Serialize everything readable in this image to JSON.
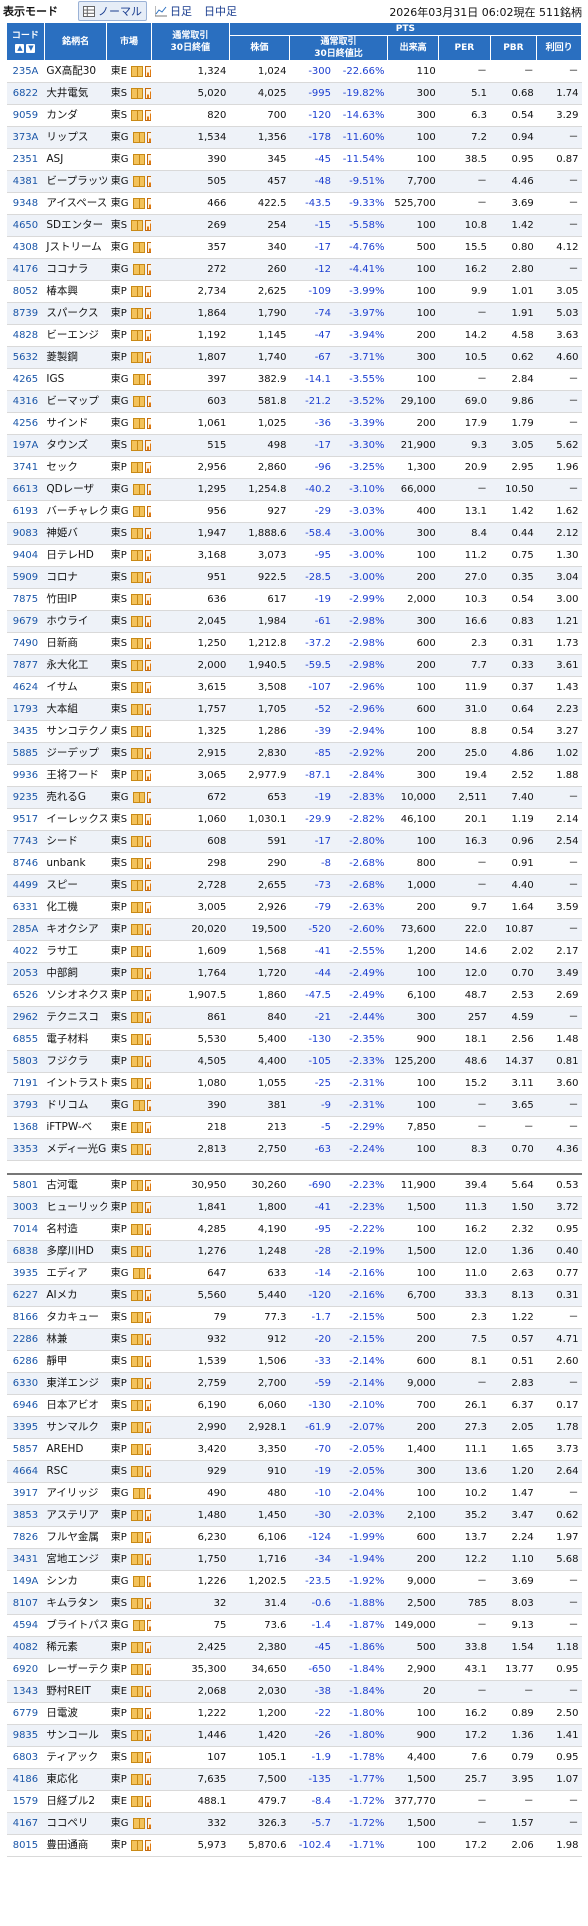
{
  "header": {
    "mode_label": "表示モード",
    "tabs": [
      "ノーマル",
      "日足",
      "日中足"
    ],
    "timestamp": "2026年03月31日  06:02現在  511銘柄"
  },
  "table_headers": {
    "code": "コード",
    "name": "銘柄名",
    "market": "市場",
    "normal_30d_avg": "通常取引\n30日終値",
    "pts_group": "PTS",
    "pts_price": "株価",
    "pts_change": "通常取引\n30日終値比",
    "volume": "出来高",
    "per": "PER",
    "pbr": "PBR",
    "yield": "利回り"
  },
  "rows": [
    [
      "235A",
      "GX高配30",
      "東E",
      "1,324",
      "1,024",
      "-300",
      "-22.66%",
      "110",
      "－",
      "－",
      "－"
    ],
    [
      "6822",
      "大井電気",
      "東S",
      "5,020",
      "4,025",
      "-995",
      "-19.82%",
      "300",
      "5.1",
      "0.68",
      "1.74"
    ],
    [
      "9059",
      "カンダ",
      "東S",
      "820",
      "700",
      "-120",
      "-14.63%",
      "300",
      "6.3",
      "0.54",
      "3.29"
    ],
    [
      "373A",
      "リップス",
      "東G",
      "1,534",
      "1,356",
      "-178",
      "-11.60%",
      "100",
      "7.2",
      "0.94",
      "－"
    ],
    [
      "2351",
      "ASJ",
      "東G",
      "390",
      "345",
      "-45",
      "-11.54%",
      "100",
      "38.5",
      "0.95",
      "0.87"
    ],
    [
      "4381",
      "ビープラッツ",
      "東G",
      "505",
      "457",
      "-48",
      "-9.51%",
      "7,700",
      "－",
      "4.46",
      "－"
    ],
    [
      "9348",
      "アイスペース",
      "東G",
      "466",
      "422.5",
      "-43.5",
      "-9.33%",
      "525,700",
      "－",
      "3.69",
      "－"
    ],
    [
      "4650",
      "SDエンター",
      "東S",
      "269",
      "254",
      "-15",
      "-5.58%",
      "100",
      "10.8",
      "1.42",
      "－"
    ],
    [
      "4308",
      "Jストリーム",
      "東G",
      "357",
      "340",
      "-17",
      "-4.76%",
      "500",
      "15.5",
      "0.80",
      "4.12"
    ],
    [
      "4176",
      "ココナラ",
      "東G",
      "272",
      "260",
      "-12",
      "-4.41%",
      "100",
      "16.2",
      "2.80",
      "－"
    ],
    [
      "8052",
      "椿本興",
      "東P",
      "2,734",
      "2,625",
      "-109",
      "-3.99%",
      "100",
      "9.9",
      "1.01",
      "3.05"
    ],
    [
      "8739",
      "スパークス",
      "東P",
      "1,864",
      "1,790",
      "-74",
      "-3.97%",
      "100",
      "－",
      "1.91",
      "5.03"
    ],
    [
      "4828",
      "ビーエンジ",
      "東P",
      "1,192",
      "1,145",
      "-47",
      "-3.94%",
      "200",
      "14.2",
      "4.58",
      "3.63"
    ],
    [
      "5632",
      "菱製鋼",
      "東P",
      "1,807",
      "1,740",
      "-67",
      "-3.71%",
      "300",
      "10.5",
      "0.62",
      "4.60"
    ],
    [
      "4265",
      "IGS",
      "東G",
      "397",
      "382.9",
      "-14.1",
      "-3.55%",
      "100",
      "－",
      "2.84",
      "－"
    ],
    [
      "4316",
      "ビーマップ",
      "東G",
      "603",
      "581.8",
      "-21.2",
      "-3.52%",
      "29,100",
      "69.0",
      "9.86",
      "－"
    ],
    [
      "4256",
      "サインド",
      "東G",
      "1,061",
      "1,025",
      "-36",
      "-3.39%",
      "200",
      "17.9",
      "1.79",
      "－"
    ],
    [
      "197A",
      "タウンズ",
      "東S",
      "515",
      "498",
      "-17",
      "-3.30%",
      "21,900",
      "9.3",
      "3.05",
      "5.62"
    ],
    [
      "3741",
      "セック",
      "東P",
      "2,956",
      "2,860",
      "-96",
      "-3.25%",
      "1,300",
      "20.9",
      "2.95",
      "1.96"
    ],
    [
      "6613",
      "QDレーザ",
      "東G",
      "1,295",
      "1,254.8",
      "-40.2",
      "-3.10%",
      "66,000",
      "－",
      "10.50",
      "－"
    ],
    [
      "6193",
      "バーチャレク",
      "東G",
      "956",
      "927",
      "-29",
      "-3.03%",
      "400",
      "13.1",
      "1.42",
      "1.62"
    ],
    [
      "9083",
      "神姫バ",
      "東S",
      "1,947",
      "1,888.6",
      "-58.4",
      "-3.00%",
      "300",
      "8.4",
      "0.44",
      "2.12"
    ],
    [
      "9404",
      "日テレHD",
      "東P",
      "3,168",
      "3,073",
      "-95",
      "-3.00%",
      "100",
      "11.2",
      "0.75",
      "1.30"
    ],
    [
      "5909",
      "コロナ",
      "東S",
      "951",
      "922.5",
      "-28.5",
      "-3.00%",
      "200",
      "27.0",
      "0.35",
      "3.04"
    ],
    [
      "7875",
      "竹田IP",
      "東S",
      "636",
      "617",
      "-19",
      "-2.99%",
      "2,000",
      "10.3",
      "0.54",
      "3.00"
    ],
    [
      "9679",
      "ホウライ",
      "東S",
      "2,045",
      "1,984",
      "-61",
      "-2.98%",
      "300",
      "16.6",
      "0.83",
      "1.21"
    ],
    [
      "7490",
      "日新商",
      "東S",
      "1,250",
      "1,212.8",
      "-37.2",
      "-2.98%",
      "600",
      "2.3",
      "0.31",
      "1.73"
    ],
    [
      "7877",
      "永大化工",
      "東S",
      "2,000",
      "1,940.5",
      "-59.5",
      "-2.98%",
      "200",
      "7.7",
      "0.33",
      "3.61"
    ],
    [
      "4624",
      "イサム",
      "東S",
      "3,615",
      "3,508",
      "-107",
      "-2.96%",
      "100",
      "11.9",
      "0.37",
      "1.43"
    ],
    [
      "1793",
      "大本組",
      "東S",
      "1,757",
      "1,705",
      "-52",
      "-2.96%",
      "600",
      "31.0",
      "0.64",
      "2.23"
    ],
    [
      "3435",
      "サンコテクノ",
      "東S",
      "1,325",
      "1,286",
      "-39",
      "-2.94%",
      "100",
      "8.8",
      "0.54",
      "3.27"
    ],
    [
      "5885",
      "ジーデップ",
      "東S",
      "2,915",
      "2,830",
      "-85",
      "-2.92%",
      "200",
      "25.0",
      "4.86",
      "1.02"
    ],
    [
      "9936",
      "王将フード",
      "東P",
      "3,065",
      "2,977.9",
      "-87.1",
      "-2.84%",
      "300",
      "19.4",
      "2.52",
      "1.88"
    ],
    [
      "9235",
      "売れるG",
      "東G",
      "672",
      "653",
      "-19",
      "-2.83%",
      "10,000",
      "2,511",
      "7.40",
      "－"
    ],
    [
      "9517",
      "イーレックス",
      "東S",
      "1,060",
      "1,030.1",
      "-29.9",
      "-2.82%",
      "46,100",
      "20.1",
      "1.19",
      "2.14"
    ],
    [
      "7743",
      "シード",
      "東S",
      "608",
      "591",
      "-17",
      "-2.80%",
      "100",
      "16.3",
      "0.96",
      "2.54"
    ],
    [
      "8746",
      "unbank",
      "東S",
      "298",
      "290",
      "-8",
      "-2.68%",
      "800",
      "－",
      "0.91",
      "－"
    ],
    [
      "4499",
      "スピー",
      "東S",
      "2,728",
      "2,655",
      "-73",
      "-2.68%",
      "1,000",
      "－",
      "4.40",
      "－"
    ],
    [
      "6331",
      "化工機",
      "東P",
      "3,005",
      "2,926",
      "-79",
      "-2.63%",
      "200",
      "9.7",
      "1.64",
      "3.59"
    ],
    [
      "285A",
      "キオクシア",
      "東P",
      "20,020",
      "19,500",
      "-520",
      "-2.60%",
      "73,600",
      "22.0",
      "10.87",
      "－"
    ],
    [
      "4022",
      "ラサ工",
      "東P",
      "1,609",
      "1,568",
      "-41",
      "-2.55%",
      "1,200",
      "14.6",
      "2.02",
      "2.17"
    ],
    [
      "2053",
      "中部飼",
      "東P",
      "1,764",
      "1,720",
      "-44",
      "-2.49%",
      "100",
      "12.0",
      "0.70",
      "3.49"
    ],
    [
      "6526",
      "ソシオネクス",
      "東P",
      "1,907.5",
      "1,860",
      "-47.5",
      "-2.49%",
      "6,100",
      "48.7",
      "2.53",
      "2.69"
    ],
    [
      "2962",
      "テクニスコ",
      "東S",
      "861",
      "840",
      "-21",
      "-2.44%",
      "300",
      "257",
      "4.59",
      "－"
    ],
    [
      "6855",
      "電子材料",
      "東S",
      "5,530",
      "5,400",
      "-130",
      "-2.35%",
      "900",
      "18.1",
      "2.56",
      "1.48"
    ],
    [
      "5803",
      "フジクラ",
      "東P",
      "4,505",
      "4,400",
      "-105",
      "-2.33%",
      "125,200",
      "48.6",
      "14.37",
      "0.81"
    ],
    [
      "7191",
      "イントラスト",
      "東S",
      "1,080",
      "1,055",
      "-25",
      "-2.31%",
      "100",
      "15.2",
      "3.11",
      "3.60"
    ],
    [
      "3793",
      "ドリコム",
      "東G",
      "390",
      "381",
      "-9",
      "-2.31%",
      "100",
      "－",
      "3.65",
      "－"
    ],
    [
      "1368",
      "iFTPW-べ",
      "東E",
      "218",
      "213",
      "-5",
      "-2.29%",
      "7,850",
      "－",
      "－",
      "－"
    ],
    [
      "3353",
      "メディ一光G",
      "東S",
      "2,813",
      "2,750",
      "-63",
      "-2.24%",
      "100",
      "8.3",
      "0.70",
      "4.36"
    ],
    null,
    [
      "5801",
      "古河電",
      "東P",
      "30,950",
      "30,260",
      "-690",
      "-2.23%",
      "11,900",
      "39.4",
      "5.64",
      "0.53"
    ],
    [
      "3003",
      "ヒューリック",
      "東P",
      "1,841",
      "1,800",
      "-41",
      "-2.23%",
      "1,500",
      "11.3",
      "1.50",
      "3.72"
    ],
    [
      "7014",
      "名村造",
      "東P",
      "4,285",
      "4,190",
      "-95",
      "-2.22%",
      "100",
      "16.2",
      "2.32",
      "0.95"
    ],
    [
      "6838",
      "多摩川HD",
      "東S",
      "1,276",
      "1,248",
      "-28",
      "-2.19%",
      "1,500",
      "12.0",
      "1.36",
      "0.40"
    ],
    [
      "3935",
      "エディア",
      "東G",
      "647",
      "633",
      "-14",
      "-2.16%",
      "100",
      "11.0",
      "2.63",
      "0.77"
    ],
    [
      "6227",
      "AIメカ",
      "東S",
      "5,560",
      "5,440",
      "-120",
      "-2.16%",
      "6,700",
      "33.3",
      "8.13",
      "0.31"
    ],
    [
      "8166",
      "タカキュー",
      "東S",
      "79",
      "77.3",
      "-1.7",
      "-2.15%",
      "500",
      "2.3",
      "1.22",
      "－"
    ],
    [
      "2286",
      "林兼",
      "東S",
      "932",
      "912",
      "-20",
      "-2.15%",
      "200",
      "7.5",
      "0.57",
      "4.71"
    ],
    [
      "6286",
      "靜甲",
      "東S",
      "1,539",
      "1,506",
      "-33",
      "-2.14%",
      "600",
      "8.1",
      "0.51",
      "2.60"
    ],
    [
      "6330",
      "東洋エンジ",
      "東P",
      "2,759",
      "2,700",
      "-59",
      "-2.14%",
      "9,000",
      "－",
      "2.83",
      "－"
    ],
    [
      "6946",
      "日本アビオ",
      "東S",
      "6,190",
      "6,060",
      "-130",
      "-2.10%",
      "700",
      "26.1",
      "6.37",
      "0.17"
    ],
    [
      "3395",
      "サンマルク",
      "東P",
      "2,990",
      "2,928.1",
      "-61.9",
      "-2.07%",
      "200",
      "27.3",
      "2.05",
      "1.78"
    ],
    [
      "5857",
      "AREHD",
      "東P",
      "3,420",
      "3,350",
      "-70",
      "-2.05%",
      "1,400",
      "11.1",
      "1.65",
      "3.73"
    ],
    [
      "4664",
      "RSC",
      "東S",
      "929",
      "910",
      "-19",
      "-2.05%",
      "300",
      "13.6",
      "1.20",
      "2.64"
    ],
    [
      "3917",
      "アイリッジ",
      "東G",
      "490",
      "480",
      "-10",
      "-2.04%",
      "100",
      "10.2",
      "1.47",
      "－"
    ],
    [
      "3853",
      "アステリア",
      "東P",
      "1,480",
      "1,450",
      "-30",
      "-2.03%",
      "2,100",
      "35.2",
      "3.47",
      "0.62"
    ],
    [
      "7826",
      "フルヤ金属",
      "東P",
      "6,230",
      "6,106",
      "-124",
      "-1.99%",
      "600",
      "13.7",
      "2.24",
      "1.97"
    ],
    [
      "3431",
      "宮地エンジ",
      "東P",
      "1,750",
      "1,716",
      "-34",
      "-1.94%",
      "200",
      "12.2",
      "1.10",
      "5.68"
    ],
    [
      "149A",
      "シンカ",
      "東G",
      "1,226",
      "1,202.5",
      "-23.5",
      "-1.92%",
      "9,000",
      "－",
      "3.69",
      "－"
    ],
    [
      "8107",
      "キムラタン",
      "東S",
      "32",
      "31.4",
      "-0.6",
      "-1.88%",
      "2,500",
      "785",
      "8.03",
      "－"
    ],
    [
      "4594",
      "ブライトパス",
      "東G",
      "75",
      "73.6",
      "-1.4",
      "-1.87%",
      "149,000",
      "－",
      "9.13",
      "－"
    ],
    [
      "4082",
      "稀元素",
      "東P",
      "2,425",
      "2,380",
      "-45",
      "-1.86%",
      "500",
      "33.8",
      "1.54",
      "1.18"
    ],
    [
      "6920",
      "レーザーテク",
      "東P",
      "35,300",
      "34,650",
      "-650",
      "-1.84%",
      "2,900",
      "43.1",
      "13.77",
      "0.95"
    ],
    [
      "1343",
      "野村REIT",
      "東E",
      "2,068",
      "2,030",
      "-38",
      "-1.84%",
      "20",
      "－",
      "－",
      "－"
    ],
    [
      "6779",
      "日電波",
      "東P",
      "1,222",
      "1,200",
      "-22",
      "-1.80%",
      "100",
      "16.2",
      "0.89",
      "2.50"
    ],
    [
      "9835",
      "サンコール",
      "東S",
      "1,446",
      "1,420",
      "-26",
      "-1.80%",
      "900",
      "17.2",
      "1.36",
      "1.41"
    ],
    [
      "6803",
      "ティアック",
      "東S",
      "107",
      "105.1",
      "-1.9",
      "-1.78%",
      "4,400",
      "7.6",
      "0.79",
      "0.95"
    ],
    [
      "4186",
      "東応化",
      "東P",
      "7,635",
      "7,500",
      "-135",
      "-1.77%",
      "1,500",
      "25.7",
      "3.95",
      "1.07"
    ],
    [
      "1579",
      "日経ブル2",
      "東E",
      "488.1",
      "479.7",
      "-8.4",
      "-1.72%",
      "377,770",
      "－",
      "－",
      "－"
    ],
    [
      "4167",
      "ココペリ",
      "東G",
      "332",
      "326.3",
      "-5.7",
      "-1.72%",
      "1,500",
      "－",
      "1.57",
      "－"
    ],
    [
      "8015",
      "豊田通商",
      "東P",
      "5,973",
      "5,870.6",
      "-102.4",
      "-1.71%",
      "100",
      "17.2",
      "2.06",
      "1.98"
    ]
  ]
}
